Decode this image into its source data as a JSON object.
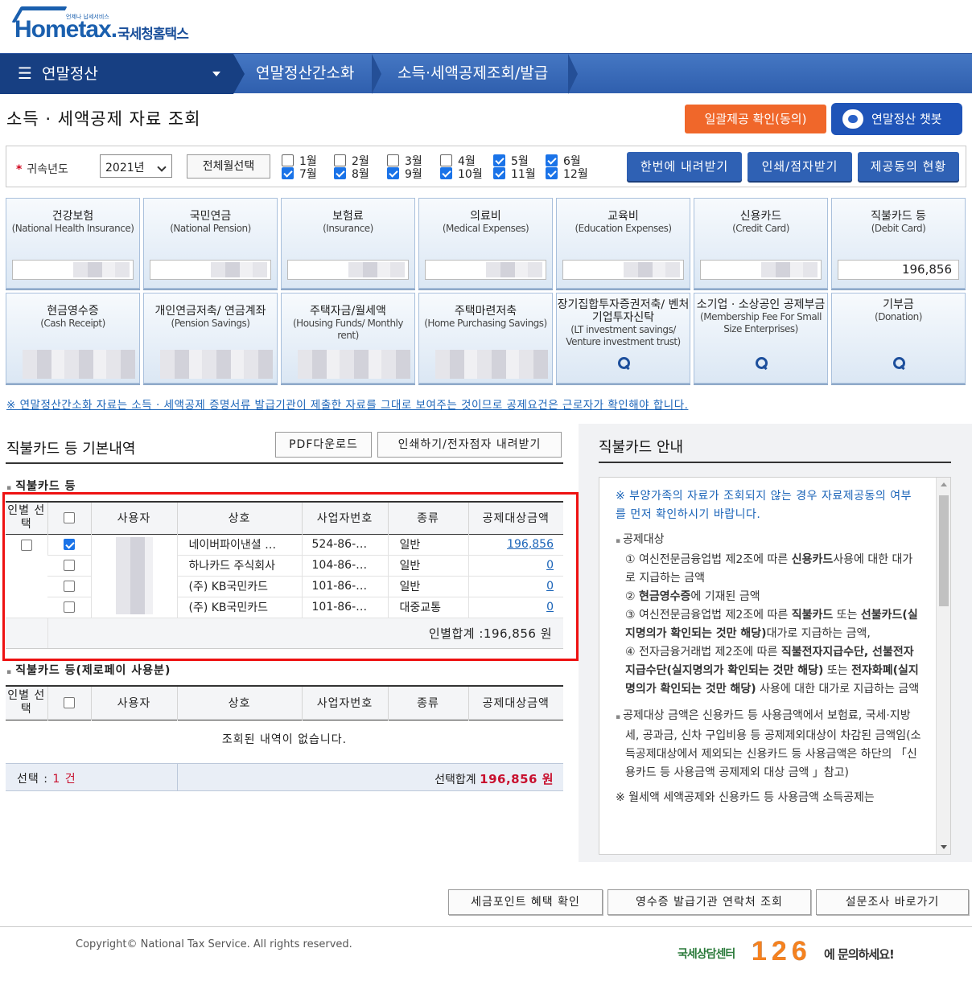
{
  "header": {
    "logo_text": "Hometax.",
    "logo_sub": "국세청홈택스",
    "logo_tiny": "언제나 납세서비스"
  },
  "nav": {
    "menu_label": "연말정산",
    "crumb1": "연말정산간소화",
    "crumb2": "소득·세액공제조회/발급"
  },
  "page": {
    "title": "소득 · 세액공제 자료 조회",
    "btn_confirm": "일괄제공 확인(동의)",
    "btn_chatbot": "연말정산 챗봇"
  },
  "filter": {
    "year_label": "귀속년도",
    "required_mark": "*",
    "year_value": "2021년",
    "btn_all_month": "전체월선택",
    "months": [
      {
        "label": "1월",
        "checked": false
      },
      {
        "label": "2월",
        "checked": false
      },
      {
        "label": "3월",
        "checked": false
      },
      {
        "label": "4월",
        "checked": false
      },
      {
        "label": "5월",
        "checked": true
      },
      {
        "label": "6월",
        "checked": true
      },
      {
        "label": "7월",
        "checked": true
      },
      {
        "label": "8월",
        "checked": true
      },
      {
        "label": "9월",
        "checked": true
      },
      {
        "label": "10월",
        "checked": true
      },
      {
        "label": "11월",
        "checked": true
      },
      {
        "label": "12월",
        "checked": true
      }
    ],
    "btn_download_all": "한번에 내려받기",
    "btn_print": "인쇄/점자받기",
    "btn_consent_status": "제공동의 현황"
  },
  "tiles_row1": [
    {
      "ko": "건강보험",
      "en": "(National Health Insurance)",
      "value": ""
    },
    {
      "ko": "국민연금",
      "en": "(National Pension)",
      "value": ""
    },
    {
      "ko": "보험료",
      "en": "(Insurance)",
      "value": ""
    },
    {
      "ko": "의료비",
      "en": "(Medical Expenses)",
      "value": ""
    },
    {
      "ko": "교육비",
      "en": "(Education Expenses)",
      "value": ""
    },
    {
      "ko": "신용카드",
      "en": "(Credit Card)",
      "value": ""
    },
    {
      "ko": "직불카드 등",
      "en": "(Debit Card)",
      "value": "196,856"
    }
  ],
  "tiles_row2": [
    {
      "ko": "현금영수증",
      "en": "(Cash Receipt)"
    },
    {
      "ko": "개인연금저축/ 연금계좌",
      "en": "(Pension Savings)"
    },
    {
      "ko": "주택자금/월세액",
      "en": "(Housing Funds/ Monthly rent)"
    },
    {
      "ko": "주택마련저축",
      "en": "(Home Purchasing Savings)"
    },
    {
      "ko": "장기집합투자증권저축/ 벤처기업투자신탁",
      "en": "(LT investment savings/ Venture investment trust)"
    },
    {
      "ko": "소기업 · 소상공인 공제부금",
      "en": "(Membership Fee For Small Size Enterprises)"
    },
    {
      "ko": "기부금",
      "en": "(Donation)"
    }
  ],
  "notice": "※ 연말정산간소화 자료는 소득 · 세액공제 증명서류 발급기관이 제출한 자료를 그대로 보여주는 것이므로 공제요건은 근로자가 확인해야 합니다.",
  "left": {
    "section_title": "직불카드 등 기본내역",
    "btn_pdf": "PDF다운로드",
    "btn_print_braille": "인쇄하기/전자점자 내려받기",
    "table1_title": "직불카드 등",
    "columns": [
      "인별 선택",
      "사용자",
      "상호",
      "사업자번호",
      "종류",
      "공제대상금액"
    ],
    "rows": [
      {
        "checked": true,
        "merchant": "네이버파이낸셜 …",
        "bizno": "524-86-…",
        "kind": "일반",
        "amount": "196,856"
      },
      {
        "checked": false,
        "merchant": "하나카드 주식회사",
        "bizno": "104-86-…",
        "kind": "일반",
        "amount": "0"
      },
      {
        "checked": false,
        "merchant": "(주) KB국민카드",
        "bizno": "101-86-…",
        "kind": "일반",
        "amount": "0"
      },
      {
        "checked": false,
        "merchant": "(주) KB국민카드",
        "bizno": "101-86-…",
        "kind": "대중교통",
        "amount": "0"
      }
    ],
    "person_total": "인별합계 :196,856 원",
    "table2_title": "직불카드 등(제로페이 사용분)",
    "table2_empty": "조회된 내역이 없습니다.",
    "selected_label": "선택 :",
    "selected_count": "1 건",
    "selected_total_label": "선택합계",
    "selected_total_value": "196,856 원"
  },
  "right": {
    "title": "직불카드 안내",
    "notice": "※ 부양가족의 자료가 조회되지 않는 경우 자료제공동의 여부를 먼저 확인하시기 바랍니다.",
    "target_label": "공제대상",
    "p1a": "① 여신전문금융업법 제2조에 따른 ",
    "p1b": "신용카드",
    "p1c": "사용에 대한 대가로 지급하는 금액",
    "p2a": "② ",
    "p2b": "현금영수증",
    "p2c": "에 기재된 금액",
    "p3a": "③ 여신전문금융업법 제2조에 따른 ",
    "p3b": "직불카드",
    "p3c": " 또는 ",
    "p3d": "선불카드(실지명의가 확인되는 것만 해당)",
    "p3e": "대가로 지급하는 금액,",
    "p4a": "④ 전자금융거래법 제2조에 따른 ",
    "p4b": "직불전자지급수단, 선불전자지급수단(실지명의가 확인되는 것만 해당)",
    "p4c": " 또는 ",
    "p4d": "전자화폐(실지명의가 확인되는 것만 해당)",
    "p4e": " 사용에 대한 대가로 지급하는 금액",
    "p5": "공제대상 금액은 신용카드 등 사용금액에서 보험료, 국세·지방세, 공과금, 신차 구입비용 등 공제제외대상이 차감된 금액임(소득공제대상에서 제외되는 신용카드 등 사용금액은 하단의 「신용카드 등 사용금액 공제제외 대상 금액 」참고)",
    "p6": "※ 월세액 세액공제와 신용카드 등 사용금액 소득공제는"
  },
  "bottom_buttons": {
    "b1": "세금포인트 혜택 확인",
    "b2": "영수증 발급기관 연락처 조회",
    "b3": "설문조사 바로가기"
  },
  "footer": {
    "copyright": "Copyright© National Tax Service. All rights reserved.",
    "call_prefix": "국세상담센터",
    "call_number": "126",
    "call_suffix": "에 문의하세요!"
  }
}
